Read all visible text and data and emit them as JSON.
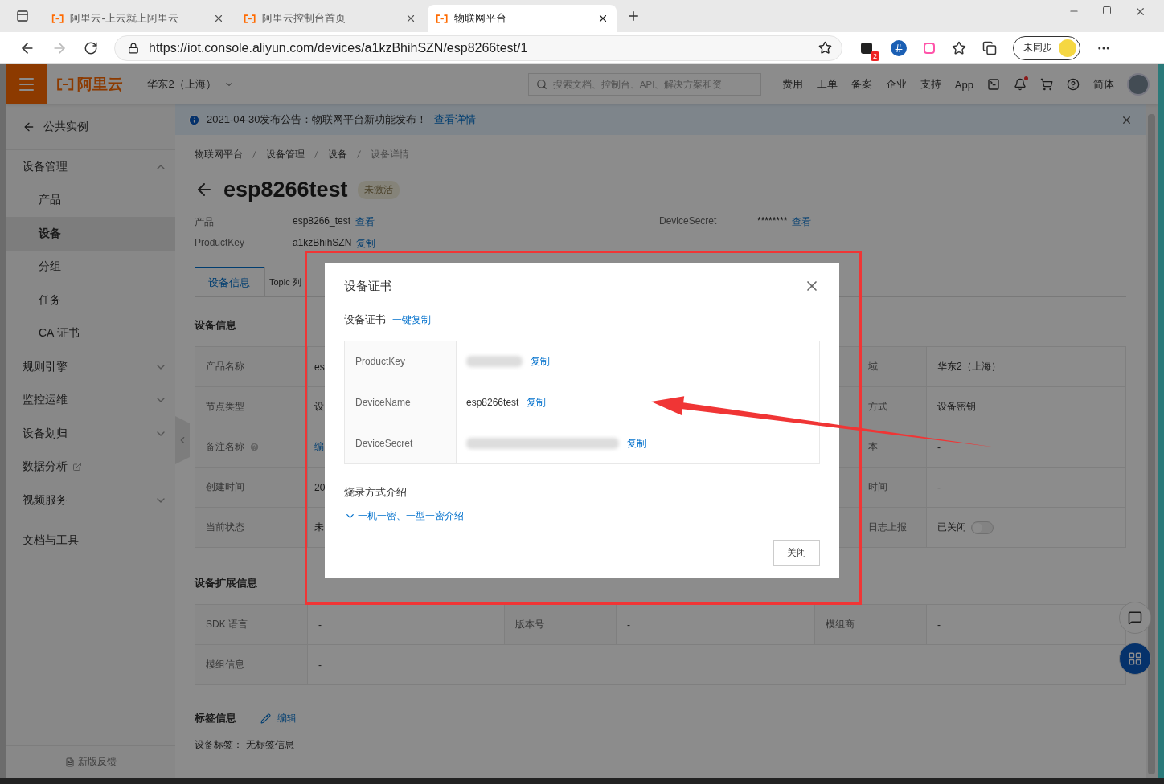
{
  "browser": {
    "tabs": [
      {
        "title": "阿里云-上云就上阿里云",
        "selected": false
      },
      {
        "title": "阿里云控制台首页",
        "selected": false
      },
      {
        "title": "物联网平台",
        "selected": true
      }
    ],
    "url": "https://iot.console.aliyun.com/devices/a1kzBhihSZN/esp8266test/1",
    "extension_badge": "2",
    "profile_button": "未同步"
  },
  "header": {
    "logo": "阿里云",
    "region": "华东2（上海）",
    "search": {
      "placeholder": "搜索文档、控制台、API、解决方案和资"
    },
    "nav": [
      "费用",
      "工单",
      "备案",
      "企业",
      "支持",
      "App"
    ],
    "language": "简体"
  },
  "sidebar": {
    "back": "公共实例",
    "items": [
      {
        "label": "设备管理",
        "kind": "group",
        "expanded": true,
        "children": [
          {
            "label": "产品",
            "selected": false
          },
          {
            "label": "设备",
            "selected": true
          },
          {
            "label": "分组",
            "selected": false
          },
          {
            "label": "任务",
            "selected": false
          },
          {
            "label": "CA 证书",
            "selected": false
          }
        ]
      },
      {
        "label": "规则引擎",
        "kind": "group",
        "expanded": false
      },
      {
        "label": "监控运维",
        "kind": "group",
        "expanded": false
      },
      {
        "label": "设备划归",
        "kind": "group",
        "expanded": false
      },
      {
        "label": "数据分析",
        "kind": "external"
      },
      {
        "label": "视频服务",
        "kind": "group",
        "expanded": false
      }
    ],
    "docs": "文档与工具",
    "feedback": "新版反馈"
  },
  "notice": {
    "text": "2021-04-30发布公告：物联网平台新功能发布！",
    "link": "查看详情"
  },
  "breadcrumb": [
    "物联网平台",
    "设备管理",
    "设备",
    "设备详情"
  ],
  "device": {
    "name": "esp8266test",
    "status": "未激活",
    "fields": [
      {
        "label": "产品",
        "value": "esp8266_test",
        "action": "查看"
      },
      {
        "label": "DeviceSecret",
        "value": "********",
        "action": "查看"
      },
      {
        "label": "ProductKey",
        "value": "a1kzBhihSZN",
        "action": "复制"
      }
    ]
  },
  "detail_tabs": [
    {
      "label": "设备信息",
      "selected": true
    },
    {
      "label": "Topic 列",
      "selected": false
    }
  ],
  "device_info": {
    "title": "设备信息",
    "rows": [
      {
        "label": "产品名称",
        "help": false,
        "value": "es",
        "kind": "text",
        "right_label": "域",
        "right_value": "华东2（上海）"
      },
      {
        "label": "节点类型",
        "help": false,
        "value": "设",
        "kind": "text",
        "right_label": "方式",
        "right_value": "设备密钥"
      },
      {
        "label": "备注名称",
        "help": true,
        "value": "编",
        "kind": "link",
        "right_label": "本",
        "right_value": "-"
      },
      {
        "label": "创建时间",
        "help": false,
        "value": "20",
        "kind": "text",
        "right_label": "时间",
        "right_value": "-"
      },
      {
        "label": "当前状态",
        "help": false,
        "value": "未",
        "kind": "text",
        "right_label": "日志上报",
        "right_value": "已关闭",
        "switch": {
          "on": false
        }
      }
    ]
  },
  "extension_info": {
    "title": "设备扩展信息",
    "rows": [
      [
        "SDK 语言",
        "-",
        "版本号",
        "-",
        "模组商",
        "-"
      ],
      [
        "模组信息",
        "-"
      ]
    ]
  },
  "tags": {
    "title": "标签信息",
    "edit": "编辑",
    "label": "设备标签：",
    "value": "无标签信息"
  },
  "modal": {
    "title": "设备证书",
    "section": "设备证书",
    "copy_all": "一键复制",
    "rows": [
      {
        "label": "ProductKey",
        "kind": "redacted",
        "action": "复制"
      },
      {
        "label": "DeviceName",
        "kind": "text",
        "value": "esp8266test",
        "action": "复制"
      },
      {
        "label": "DeviceSecret",
        "kind": "redacted",
        "action": "复制"
      }
    ],
    "burn_title": "烧录方式介绍",
    "burn_link": {
      "text": "一机一密、一型一密介绍",
      "expanded": false
    },
    "close": "关闭"
  }
}
